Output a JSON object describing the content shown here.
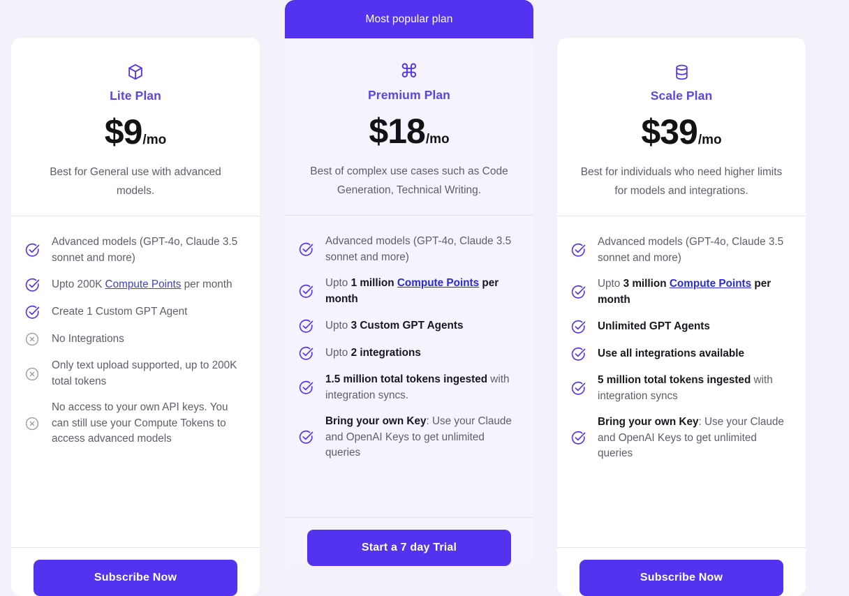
{
  "accent_color": "#5433f0",
  "page_background": "#f3f1fa",
  "featured_card_background": "#f5f3fd",
  "featured_badge": "Most popular plan",
  "plans": [
    {
      "id": "lite",
      "icon": "box-icon",
      "name": "Lite Plan",
      "price": "$9",
      "period": "/mo",
      "description": "Best for General use with advanced models.",
      "cta": "Subscribe Now",
      "features": [
        {
          "icon": "check-circle-icon",
          "parts": [
            {
              "t": "Advanced models (GPT-4o, Claude 3.5 sonnet and more)",
              "s": "muted"
            }
          ]
        },
        {
          "icon": "check-circle-icon",
          "parts": [
            {
              "t": "Upto 200K ",
              "s": "muted"
            },
            {
              "t": "Compute Points",
              "s": "link-plain"
            },
            {
              "t": " per month",
              "s": "muted"
            }
          ]
        },
        {
          "icon": "check-circle-icon",
          "parts": [
            {
              "t": "Create 1 Custom GPT Agent",
              "s": "muted"
            }
          ]
        },
        {
          "icon": "x-circle-icon",
          "parts": [
            {
              "t": "No Integrations",
              "s": "muted"
            }
          ]
        },
        {
          "icon": "x-circle-icon",
          "parts": [
            {
              "t": "Only text upload supported, up to 200K total tokens",
              "s": "muted"
            }
          ]
        },
        {
          "icon": "x-circle-icon",
          "parts": [
            {
              "t": "No access to your own API keys. You can still use your Compute Tokens to access advanced models",
              "s": "muted"
            }
          ]
        }
      ]
    },
    {
      "id": "premium",
      "icon": "command-icon",
      "name": "Premium Plan",
      "price": "$18",
      "period": "/mo",
      "description": "Best of complex use cases such as Code Generation, Technical Writing.",
      "cta": "Start a 7 day Trial",
      "features": [
        {
          "icon": "check-circle-icon",
          "parts": [
            {
              "t": "Advanced models (GPT-4o, Claude 3.5 sonnet and more)",
              "s": "muted"
            }
          ]
        },
        {
          "icon": "check-circle-icon",
          "parts": [
            {
              "t": "Upto ",
              "s": "muted"
            },
            {
              "t": "1 million ",
              "s": "bold"
            },
            {
              "t": "Compute Points",
              "s": "link-bold"
            },
            {
              "t": " per month",
              "s": "bold"
            }
          ]
        },
        {
          "icon": "check-circle-icon",
          "parts": [
            {
              "t": "Upto ",
              "s": "muted"
            },
            {
              "t": "3 Custom GPT Agents",
              "s": "bold"
            }
          ]
        },
        {
          "icon": "check-circle-icon",
          "parts": [
            {
              "t": "Upto ",
              "s": "muted"
            },
            {
              "t": "2 integrations",
              "s": "bold"
            }
          ]
        },
        {
          "icon": "check-circle-icon",
          "parts": [
            {
              "t": "1.5 million total tokens ingested",
              "s": "bold"
            },
            {
              "t": " with integration syncs.",
              "s": "muted"
            }
          ]
        },
        {
          "icon": "check-circle-icon",
          "parts": [
            {
              "t": "Bring your own Key",
              "s": "bold"
            },
            {
              "t": ": Use your Claude and OpenAI Keys to get unlimited queries",
              "s": "muted"
            }
          ]
        }
      ]
    },
    {
      "id": "scale",
      "icon": "database-icon",
      "name": "Scale Plan",
      "price": "$39",
      "period": "/mo",
      "description": "Best for individuals who need higher limits for models and integrations.",
      "cta": "Subscribe Now",
      "features": [
        {
          "icon": "check-circle-icon",
          "parts": [
            {
              "t": "Advanced models (GPT-4o, Claude 3.5 sonnet and more)",
              "s": "muted"
            }
          ]
        },
        {
          "icon": "check-circle-icon",
          "parts": [
            {
              "t": "Upto ",
              "s": "muted"
            },
            {
              "t": "3 million ",
              "s": "bold"
            },
            {
              "t": "Compute Points",
              "s": "link-bold"
            },
            {
              "t": " per month",
              "s": "bold"
            }
          ]
        },
        {
          "icon": "check-circle-icon",
          "parts": [
            {
              "t": "Unlimited GPT Agents",
              "s": "bold"
            }
          ]
        },
        {
          "icon": "check-circle-icon",
          "parts": [
            {
              "t": "Use all integrations available",
              "s": "bold"
            }
          ]
        },
        {
          "icon": "check-circle-icon",
          "parts": [
            {
              "t": "5 million total tokens ingested",
              "s": "bold"
            },
            {
              "t": " with integration syncs",
              "s": "muted"
            }
          ]
        },
        {
          "icon": "check-circle-icon",
          "parts": [
            {
              "t": "Bring your own Key",
              "s": "bold"
            },
            {
              "t": ": Use your Claude and OpenAI Keys to get unlimited queries",
              "s": "muted"
            }
          ]
        }
      ]
    }
  ]
}
